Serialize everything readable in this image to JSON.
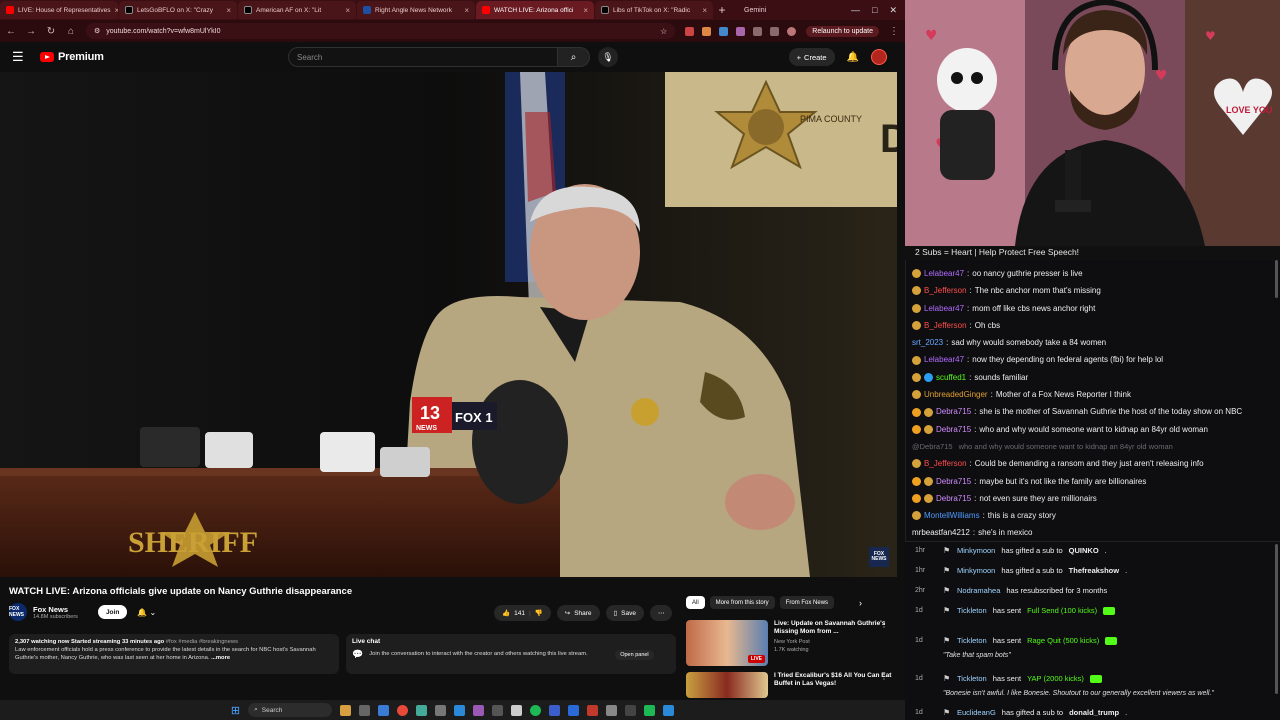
{
  "browser": {
    "tabs": [
      {
        "label": "LIVE: House of Representatives",
        "active": false,
        "color": "#ff0000"
      },
      {
        "label": "LetsGoBFLO on X: \"Crazy",
        "active": false,
        "color": "#ffffff"
      },
      {
        "label": "American AF on X: \"Lit",
        "active": false,
        "color": "#ffffff"
      },
      {
        "label": "Right Angle News Network",
        "active": false,
        "color": "#ffffff"
      },
      {
        "label": "WATCH LIVE: Arizona offici",
        "active": true,
        "color": "#ff0000"
      },
      {
        "label": "Libs of TikTok on X: \"Radic",
        "active": false,
        "color": "#ffffff"
      }
    ],
    "gemini_label": "Gemini",
    "url": "youtube.com/watch?v=wfw8mUlYkI0",
    "relaunch_label": "Relaunch to update"
  },
  "youtube": {
    "logo_text": "Premium",
    "search_placeholder": "Search",
    "create_label": "Create",
    "video": {
      "overlay_sheriff": "SHERIFF",
      "overlay_pima": "PIMA COUNTY",
      "mic_flag_13": "13",
      "mic_flag_13_sub": "NEWS",
      "mic_flag_fox": "FOX 1",
      "fox_bug": "FOX NEWS"
    },
    "title": "WATCH LIVE: Arizona officials give update on Nancy Guthrie disappearance",
    "channel": {
      "name": "Fox News",
      "subs": "14.8M subscribers",
      "join_label": "Join",
      "avatar_text": "FOX NEWS"
    },
    "actions": {
      "likes": "141",
      "share_label": "Share",
      "save_label": "Save"
    },
    "description": {
      "stats": "2,307 watching now  Started streaming 33 minutes ago",
      "tags": "#fox #media #breakingnews",
      "text": "Law enforcement officials hold a press conference to provide the latest details in the search for NBC host's Savannah Guthrie's mother, Nancy Guthrie, who was last seen at her home in Arizona.",
      "more": "...more"
    },
    "live_chat": {
      "title": "Live chat",
      "text": "Join the conversation to interact with the creator and others watching this live stream.",
      "open_panel": "Open panel"
    },
    "chips": [
      "All",
      "More from this story",
      "From Fox News"
    ],
    "recs": [
      {
        "title": "Live: Update on Savannah Guthrie's Missing Mom from ...",
        "channel": "New York Post",
        "meta": "1.7K watching",
        "badge": "LIVE"
      },
      {
        "title": "I Tried Excalibur's $16 All You Can Eat Buffet in Las Vegas!",
        "channel": "",
        "meta": "",
        "badge": ""
      }
    ]
  },
  "taskbar": {
    "search_label": "Search"
  },
  "stream": {
    "banner": "2 Subs = Heart | Help Protect Free Speech!",
    "cam_sign": "LOVE YOU"
  },
  "chat": {
    "messages": [
      {
        "user": "Lelabear47",
        "text": "oo nancy guthrie presser is live",
        "color": "#b26bff",
        "badges": [
          "#d5a13b"
        ],
        "faded": false
      },
      {
        "user": "B_Jefferson",
        "text": "The nbc anchor mom that's missing",
        "color": "#ff4d4d",
        "badges": [
          "#d5a13b"
        ],
        "faded": false
      },
      {
        "user": "Lelabear47",
        "text": "mom off like cbs news anchor right",
        "color": "#b26bff",
        "badges": [
          "#d5a13b"
        ],
        "faded": false
      },
      {
        "user": "B_Jefferson",
        "text": "Oh cbs",
        "color": "#ff4d4d",
        "badges": [
          "#d5a13b"
        ],
        "faded": false
      },
      {
        "user": "srt_2023",
        "text": "sad why would somebody take a 84 women",
        "color": "#6aa8ff",
        "badges": [],
        "faded": false
      },
      {
        "user": "Lelabear47",
        "text": "now they depending on federal agents (fbi) for help lol",
        "color": "#b26bff",
        "badges": [
          "#d5a13b"
        ],
        "faded": false
      },
      {
        "user": "scuffed1",
        "text": "sounds familiar",
        "color": "#53fc18",
        "badges": [
          "#d5a13b",
          "#2a9df4"
        ],
        "faded": false
      },
      {
        "user": "UnbreadedGinger",
        "text": "Mother of a Fox News Reporter I think",
        "color": "#e0a030",
        "badges": [
          "#d5a13b"
        ],
        "faded": false
      },
      {
        "user": "Debra715",
        "text": "she is the mother of Savannah Guthrie the host of the today show on NBC",
        "color": "#d08cff",
        "badges": [
          "#f0a020",
          "#d5a13b"
        ],
        "faded": false
      },
      {
        "user": "Debra715",
        "text": "who and why would someone want to kidnap an 84yr old woman",
        "color": "#d08cff",
        "badges": [
          "#f0a020",
          "#d5a13b"
        ],
        "faded": false
      },
      {
        "user": "@Debra715",
        "text": "who and why would someone want to kidnap an 84yr old woman",
        "color": "#6a6a70",
        "badges": [],
        "faded": true
      },
      {
        "user": "B_Jefferson",
        "text": "Could be demanding a ransom and they just aren't releasing info",
        "color": "#ff4d4d",
        "badges": [
          "#d5a13b"
        ],
        "faded": false
      },
      {
        "user": "Debra715",
        "text": "maybe but it's not like the family are billionaires",
        "color": "#d08cff",
        "badges": [
          "#f0a020",
          "#d5a13b"
        ],
        "faded": false
      },
      {
        "user": "Debra715",
        "text": "not even sure they are millionairs",
        "color": "#d08cff",
        "badges": [
          "#f0a020",
          "#d5a13b"
        ],
        "faded": false
      },
      {
        "user": "MontellWilliams",
        "text": "this is a crazy story",
        "color": "#4f9bff",
        "badges": [
          "#d5a13b"
        ],
        "faded": false
      },
      {
        "user": "mrbeastfan4212",
        "text": "she's in mexico",
        "color": "#efeff1",
        "badges": [],
        "faded": false
      }
    ],
    "events": [
      {
        "time": "1hr",
        "user": "Minkymoon",
        "action": "has gifted a sub to",
        "target": "QUINKO",
        "suffix": ".",
        "quote": ""
      },
      {
        "time": "1hr",
        "user": "Minkymoon",
        "action": "has gifted a sub to",
        "target": "Thefreakshow",
        "suffix": ".",
        "quote": ""
      },
      {
        "time": "2hr",
        "user": "Nodramahea",
        "action": "has resubscribed for 3 months",
        "target": "",
        "suffix": "",
        "quote": ""
      },
      {
        "time": "1d",
        "user": "Tickleton",
        "action": "has sent",
        "target": "Full Send (100 kicks)",
        "suffix": "",
        "quote": ""
      },
      {
        "time": "1d",
        "user": "Tickleton",
        "action": "has sent",
        "target": "Rage Quit (500 kicks)",
        "suffix": "",
        "quote": "\"Take that spam bots\""
      },
      {
        "time": "1d",
        "user": "Tickleton",
        "action": "has sent",
        "target": "YAP (2000 kicks)",
        "suffix": "",
        "quote": "\"Bonesie isn't awful. I like Bonesie. Shoutout to our generally excellent viewers as well.\""
      },
      {
        "time": "1d",
        "user": "EuclideanG",
        "action": "has gifted a sub to",
        "target": "donald_trump",
        "suffix": ".",
        "quote": ""
      }
    ]
  }
}
